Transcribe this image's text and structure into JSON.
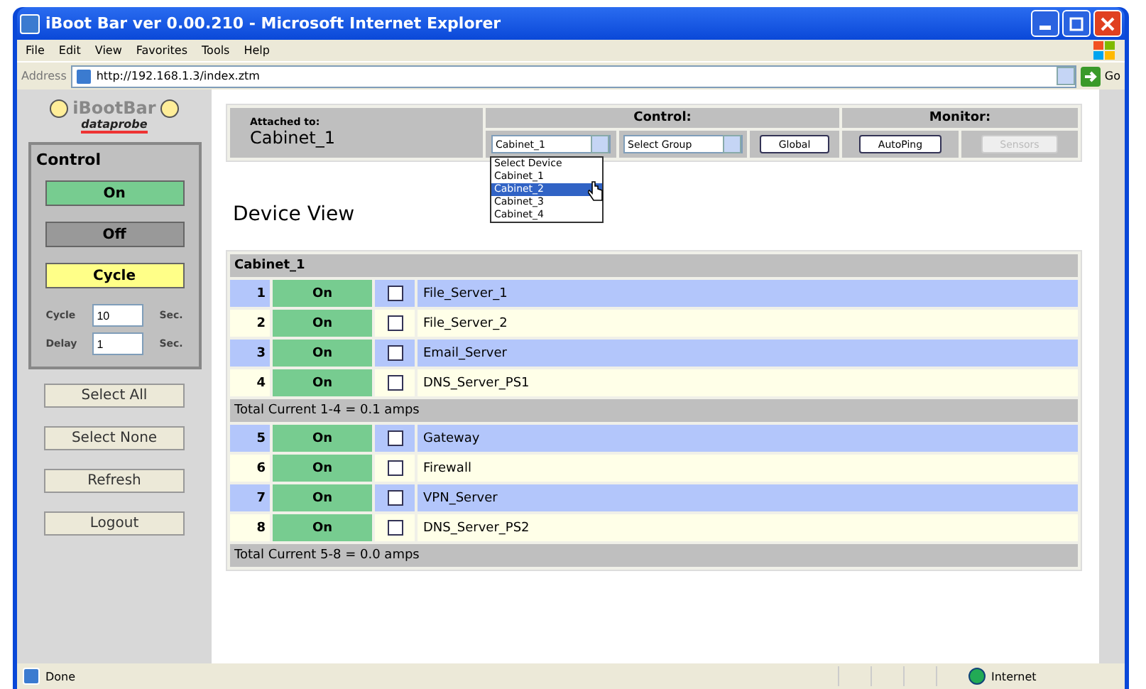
{
  "window": {
    "title": "iBoot Bar ver 0.00.210 - Microsoft Internet Explorer"
  },
  "menu": [
    "File",
    "Edit",
    "View",
    "Favorites",
    "Tools",
    "Help"
  ],
  "address": {
    "label": "Address",
    "value": "http://192.168.1.3/index.ztm",
    "go": "Go"
  },
  "sidebar": {
    "brand": "iBootBar",
    "maker": "dataprobe",
    "control_title": "Control",
    "actions": [
      {
        "label": "On",
        "kind": "on"
      },
      {
        "label": "Off",
        "kind": "off"
      },
      {
        "label": "Cycle",
        "kind": "cycle"
      }
    ],
    "fields": [
      {
        "label": "Cycle",
        "value": "10",
        "unit": "Sec."
      },
      {
        "label": "Delay",
        "value": "1",
        "unit": "Sec."
      }
    ],
    "buttons": [
      "Select All",
      "Select None",
      "Refresh",
      "Logout"
    ]
  },
  "header": {
    "attached_label": "Attached to:",
    "attached_value": "Cabinet_1",
    "control_label": "Control:",
    "monitor_label": "Monitor:",
    "device_select": "Cabinet_1",
    "group_select": "Select Group",
    "global": "Global",
    "autoping": "AutoPing",
    "sensors": {
      "label": "Sensors",
      "disabled": true
    },
    "dropdown": [
      {
        "label": "Select Device",
        "selected": false
      },
      {
        "label": "Cabinet_1",
        "selected": false
      },
      {
        "label": "Cabinet_2",
        "selected": true
      },
      {
        "label": "Cabinet_3",
        "selected": false
      },
      {
        "label": "Cabinet_4",
        "selected": false
      }
    ]
  },
  "page_title": "Device View",
  "table": {
    "title": "Cabinet_1",
    "groups": [
      {
        "outlets": [
          {
            "number": "1",
            "state": "On",
            "checked": false,
            "name": "File_Server_1"
          },
          {
            "number": "2",
            "state": "On",
            "checked": false,
            "name": "File_Server_2"
          },
          {
            "number": "3",
            "state": "On",
            "checked": false,
            "name": "Email_Server"
          },
          {
            "number": "4",
            "state": "On",
            "checked": false,
            "name": "DNS_Server_PS1"
          }
        ],
        "total": "Total Current 1-4 = 0.1 amps"
      },
      {
        "outlets": [
          {
            "number": "5",
            "state": "On",
            "checked": false,
            "name": "Gateway"
          },
          {
            "number": "6",
            "state": "On",
            "checked": false,
            "name": "Firewall"
          },
          {
            "number": "7",
            "state": "On",
            "checked": false,
            "name": "VPN_Server"
          },
          {
            "number": "8",
            "state": "On",
            "checked": false,
            "name": "DNS_Server_PS2"
          }
        ],
        "total": "Total Current 5-8 = 0.0 amps"
      }
    ]
  },
  "status_bar": {
    "text": "Done",
    "zone": "Internet"
  }
}
